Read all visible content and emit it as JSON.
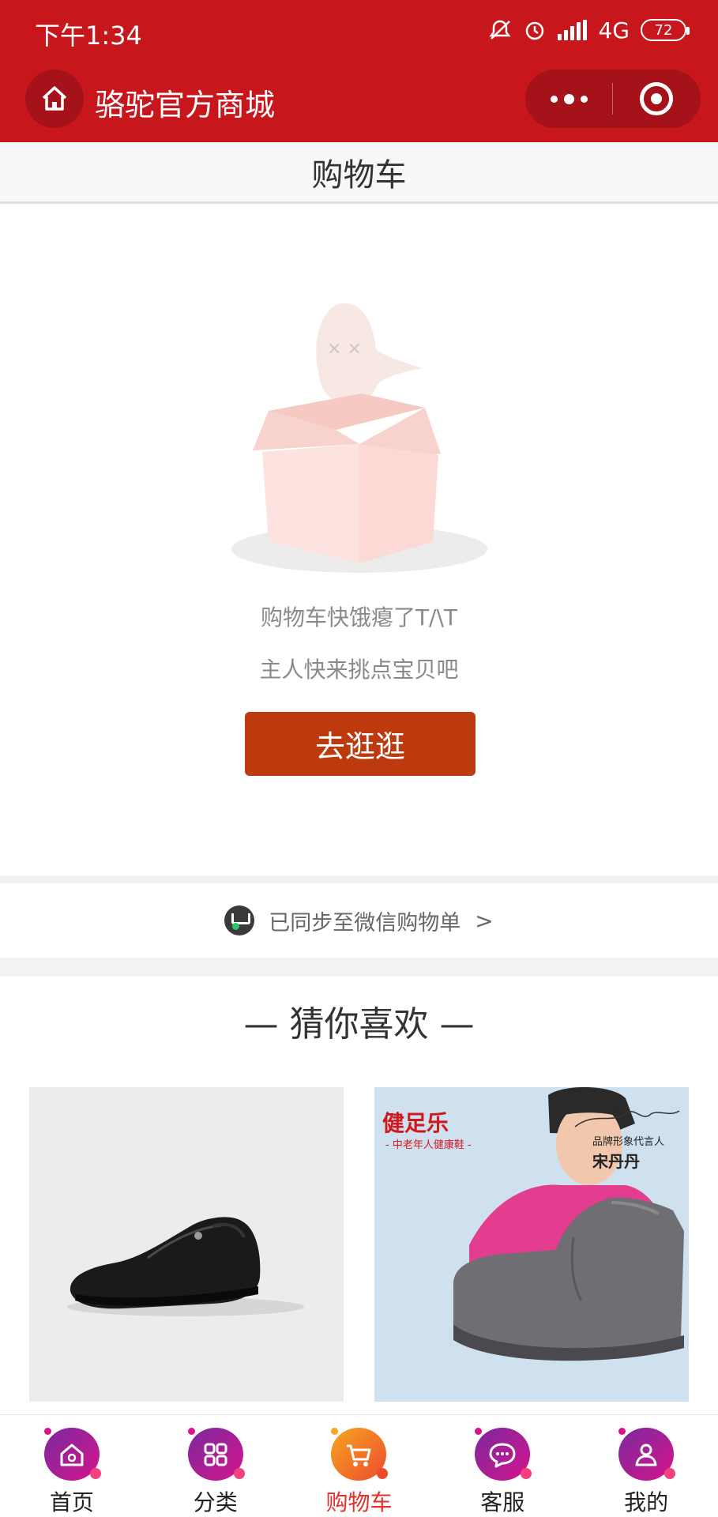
{
  "status_bar": {
    "time": "下午1:34",
    "network": "4G",
    "battery": "72"
  },
  "header": {
    "title": "骆驼官方商城"
  },
  "page": {
    "title": "购物车"
  },
  "empty_state": {
    "line1": "购物车快饿瘪了T/\\T",
    "line2": "主人快来挑点宝贝吧",
    "button_label": "去逛逛"
  },
  "sync": {
    "text": "已同步至微信购物单",
    "chevron": ">"
  },
  "recommend": {
    "title": "— 猜你喜欢 —"
  },
  "products": [
    {
      "image_alt": "black-leather-loafer"
    },
    {
      "brand": "健足乐",
      "brand_sub": "- 中老年人健康鞋 -",
      "ambassador_label": "品牌形象代言人",
      "ambassador_name": "宋丹丹"
    }
  ],
  "tabs": [
    {
      "label": "首页",
      "icon": "home-icon",
      "active": false
    },
    {
      "label": "分类",
      "icon": "category-icon",
      "active": false
    },
    {
      "label": "购物车",
      "icon": "cart-icon",
      "active": true
    },
    {
      "label": "客服",
      "icon": "service-icon",
      "active": false
    },
    {
      "label": "我的",
      "icon": "profile-icon",
      "active": false
    }
  ],
  "colors": {
    "brand_red": "#c8161d",
    "button": "#bd3a0f",
    "active_tab": "#e5302a"
  }
}
